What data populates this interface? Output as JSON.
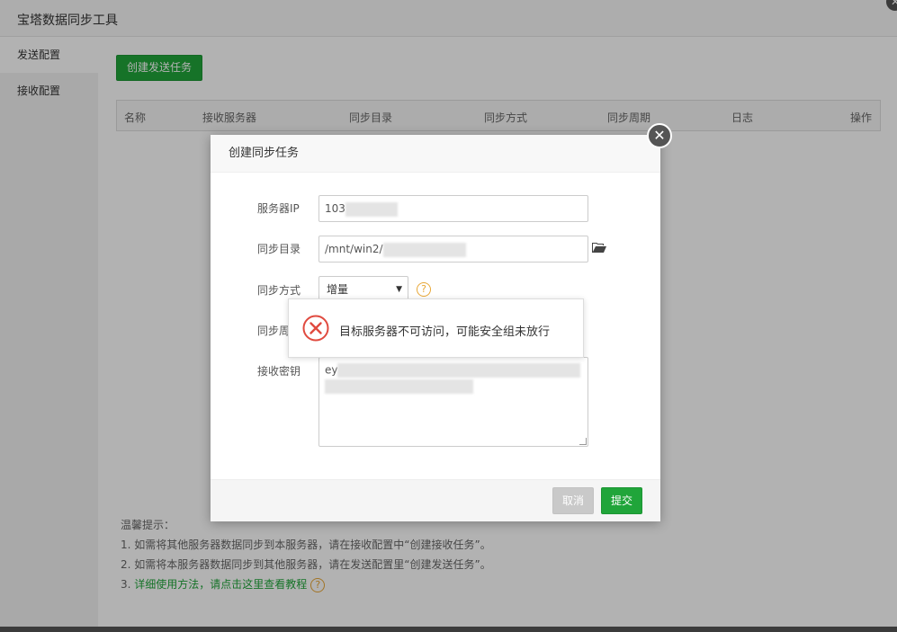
{
  "window": {
    "title": "宝塔数据同步工具",
    "close_glyph": "✕"
  },
  "sidebar": {
    "items": [
      {
        "label": "发送配置",
        "active": true
      },
      {
        "label": "接收配置",
        "active": false
      }
    ]
  },
  "main": {
    "create_button": "创建发送任务",
    "table_headers": [
      "名称",
      "接收服务器",
      "同步目录",
      "同步方式",
      "同步周期",
      "日志",
      "操作"
    ]
  },
  "tips": {
    "title": "温馨提示：",
    "line1": "1. 如需将其他服务器数据同步到本服务器，请在接收配置中“创建接收任务”。",
    "line2": "2. 如需将本服务器数据同步到其他服务器，请在发送配置里“创建发送任务”。",
    "line3_prefix": "3. ",
    "line3_link": "详细使用方法，请点击这里查看教程",
    "help_glyph": "?"
  },
  "dialog": {
    "title": "创建同步任务",
    "close_glyph": "✕",
    "fields": {
      "server_ip": {
        "label": "服务器IP",
        "value": "103"
      },
      "sync_dir": {
        "label": "同步目录",
        "value": "/mnt/win2/"
      },
      "sync_mode": {
        "label": "同步方式",
        "value": "增量",
        "arrow": "▼",
        "help_glyph": "?"
      },
      "sync_period": {
        "label": "同步周"
      },
      "recv_key": {
        "label": "接收密钥",
        "value": "ey"
      }
    },
    "buttons": {
      "cancel": "取消",
      "submit": "提交"
    }
  },
  "toast": {
    "message": "目标服务器不可访问，可能安全组未放行",
    "icon": "error-circle-icon",
    "color": "#e04a3f"
  },
  "colors": {
    "accent": "#20a53a",
    "warning": "#e8a736",
    "error": "#e04a3f"
  }
}
